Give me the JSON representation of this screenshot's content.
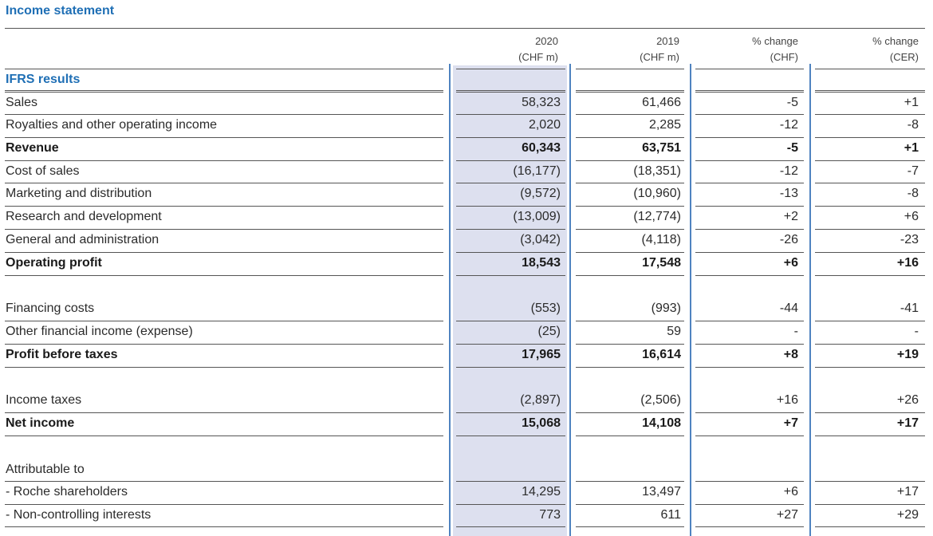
{
  "title": "Income statement",
  "headers": [
    {
      "line1": "2020",
      "line2": "(CHF m)"
    },
    {
      "line1": "2019",
      "line2": "(CHF m)"
    },
    {
      "line1": "% change",
      "line2": "(CHF)"
    },
    {
      "line1": "% change",
      "line2": "(CER)"
    }
  ],
  "rows": [
    {
      "label": "IFRS results",
      "c2020": "",
      "c2019": "",
      "chf": "",
      "cer": "",
      "style": "blue"
    },
    {
      "label": "Sales",
      "c2020": "58,323",
      "c2019": "61,466",
      "chf": "-5",
      "cer": "+1",
      "style": ""
    },
    {
      "label": "Royalties and other operating income",
      "c2020": "2,020",
      "c2019": "2,285",
      "chf": "-12",
      "cer": "-8",
      "style": ""
    },
    {
      "label": "Revenue",
      "c2020": "60,343",
      "c2019": "63,751",
      "chf": "-5",
      "cer": "+1",
      "style": "bold"
    },
    {
      "label": "Cost of sales",
      "c2020": "(16,177)",
      "c2019": "(18,351)",
      "chf": "-12",
      "cer": "-7",
      "style": ""
    },
    {
      "label": "Marketing and distribution",
      "c2020": "(9,572)",
      "c2019": "(10,960)",
      "chf": "-13",
      "cer": "-8",
      "style": ""
    },
    {
      "label": "Research and development",
      "c2020": "(13,009)",
      "c2019": "(12,774)",
      "chf": "+2",
      "cer": "+6",
      "style": ""
    },
    {
      "label": "General and administration",
      "c2020": "(3,042)",
      "c2019": "(4,118)",
      "chf": "-26",
      "cer": "-23",
      "style": ""
    },
    {
      "label": "Operating profit",
      "c2020": "18,543",
      "c2019": "17,548",
      "chf": "+6",
      "cer": "+16",
      "style": "bold"
    },
    {
      "label": "Financing costs",
      "c2020": "(553)",
      "c2019": "(993)",
      "chf": "-44",
      "cer": "-41",
      "style": ""
    },
    {
      "label": "Other financial income (expense)",
      "c2020": "(25)",
      "c2019": "59",
      "chf": "-",
      "cer": "-",
      "style": ""
    },
    {
      "label": "Profit before taxes",
      "c2020": "17,965",
      "c2019": "16,614",
      "chf": "+8",
      "cer": "+19",
      "style": "bold"
    },
    {
      "label": "Income taxes",
      "c2020": "(2,897)",
      "c2019": "(2,506)",
      "chf": "+16",
      "cer": "+26",
      "style": ""
    },
    {
      "label": "Net income",
      "c2020": "15,068",
      "c2019": "14,108",
      "chf": "+7",
      "cer": "+17",
      "style": "bold"
    },
    {
      "label": "Attributable to",
      "c2020": "",
      "c2019": "",
      "chf": "",
      "cer": "",
      "style": ""
    },
    {
      "label": "- Roche shareholders",
      "c2020": "14,295",
      "c2019": "13,497",
      "chf": "+6",
      "cer": "+17",
      "style": ""
    },
    {
      "label": "- Non-controlling interests",
      "c2020": "773",
      "c2019": "611",
      "chf": "+27",
      "cer": "+29",
      "style": ""
    }
  ]
}
